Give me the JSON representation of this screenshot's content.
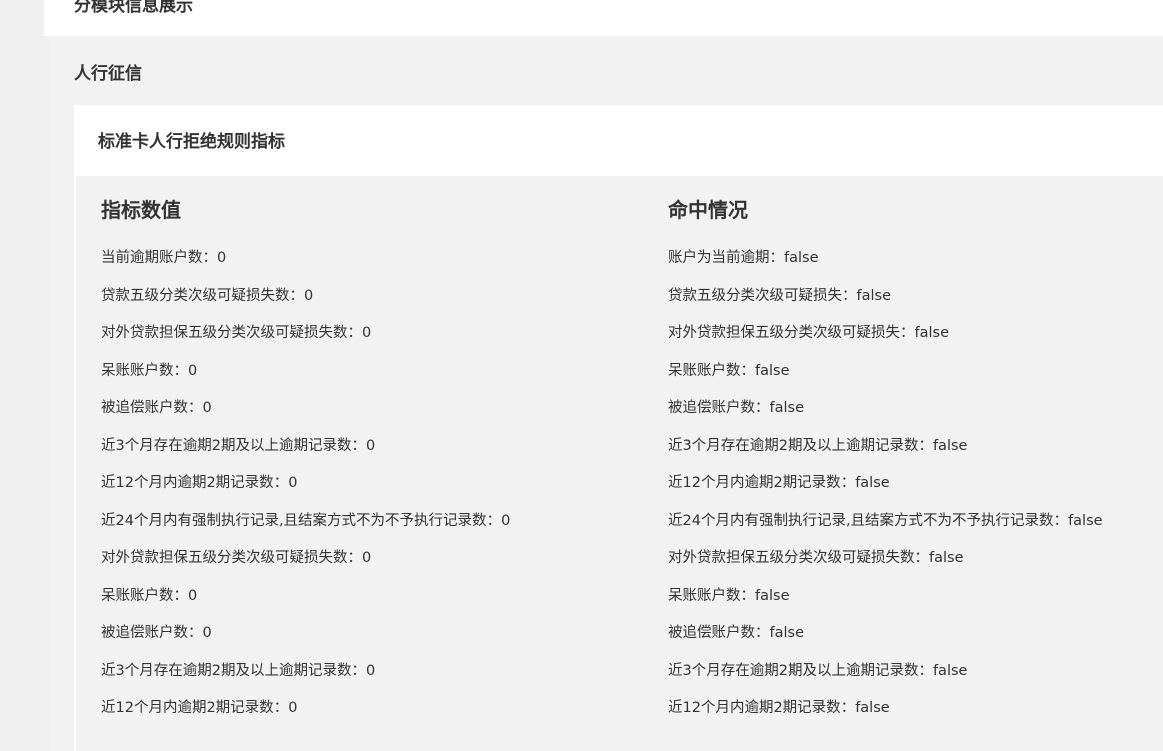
{
  "top_panel": {
    "title": "分模块信息展示"
  },
  "section": {
    "title": "人行征信"
  },
  "card": {
    "title": "标准卡人行拒绝规则指标",
    "left_column": {
      "title": "指标数值",
      "rows": [
        {
          "label": "当前逾期账户数",
          "value": "0"
        },
        {
          "label": "贷款五级分类次级可疑损失数",
          "value": "0"
        },
        {
          "label": "对外贷款担保五级分类次级可疑损失数",
          "value": "0"
        },
        {
          "label": "呆账账户数",
          "value": "0"
        },
        {
          "label": "被追偿账户数",
          "value": "0"
        },
        {
          "label": "近3个月存在逾期2期及以上逾期记录数",
          "value": "0"
        },
        {
          "label": "近12个月内逾期2期记录数",
          "value": "0"
        },
        {
          "label": "近24个月内有强制执行记录,且结案方式不为不予执行记录数",
          "value": "0"
        },
        {
          "label": "对外贷款担保五级分类次级可疑损失数",
          "value": "0"
        },
        {
          "label": "呆账账户数",
          "value": "0"
        },
        {
          "label": "被追偿账户数",
          "value": "0"
        },
        {
          "label": "近3个月存在逾期2期及以上逾期记录数",
          "value": "0"
        },
        {
          "label": "近12个月内逾期2期记录数",
          "value": "0"
        }
      ]
    },
    "right_column": {
      "title": "命中情况",
      "rows": [
        {
          "label": "账户为当前逾期",
          "value": "false"
        },
        {
          "label": "贷款五级分类次级可疑损失",
          "value": "false"
        },
        {
          "label": "对外贷款担保五级分类次级可疑损失",
          "value": "false"
        },
        {
          "label": "呆账账户数",
          "value": "false"
        },
        {
          "label": "被追偿账户数",
          "value": "false"
        },
        {
          "label": "近3个月存在逾期2期及以上逾期记录数",
          "value": "false"
        },
        {
          "label": "近12个月内逾期2期记录数",
          "value": "false"
        },
        {
          "label": "近24个月内有强制执行记录,且结案方式不为不予执行记录数",
          "value": "false"
        },
        {
          "label": "对外贷款担保五级分类次级可疑损失数",
          "value": "false"
        },
        {
          "label": "呆账账户数",
          "value": "false"
        },
        {
          "label": "被追偿账户数",
          "value": "false"
        },
        {
          "label": "近3个月存在逾期2期及以上逾期记录数",
          "value": "false"
        },
        {
          "label": "近12个月内逾期2期记录数",
          "value": "false"
        }
      ]
    },
    "separator": "："
  }
}
